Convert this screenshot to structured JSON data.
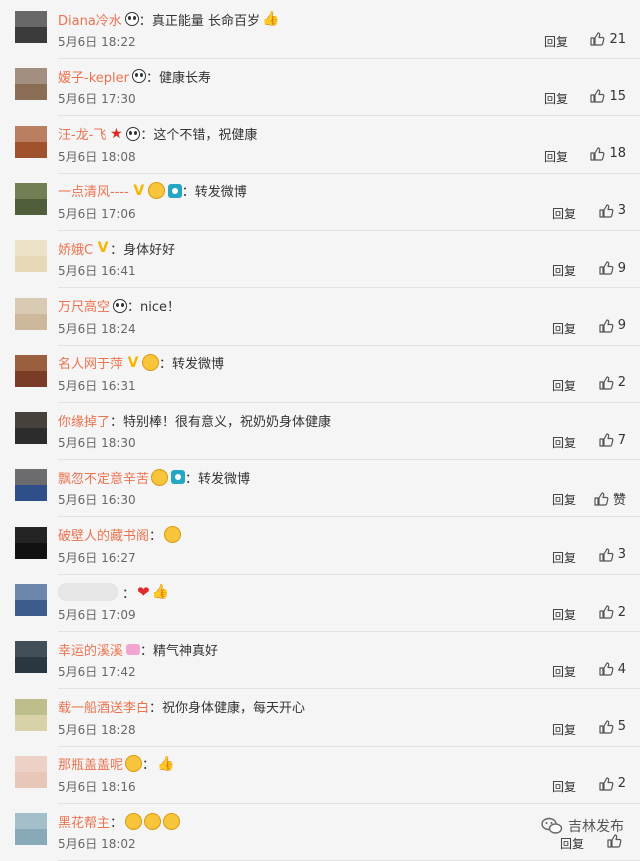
{
  "colors": {
    "username": "#eb7350",
    "text": "#333333",
    "meta": "#666666",
    "divider": "#e2e2e2"
  },
  "reply_label": "回复",
  "watermark": {
    "text": "吉林发布",
    "icon": "wechat-icon"
  },
  "comments": [
    {
      "user": "Diana冷水",
      "badges": [
        "panda"
      ],
      "text": "真正能量 长命百岁",
      "trail": [
        "thumb"
      ],
      "time": "5月6日 18:22",
      "likes": "21",
      "avatar": [
        "#3b3b3b",
        "#bdbdbd"
      ]
    },
    {
      "user": "嫒子-kepler",
      "badges": [
        "panda"
      ],
      "text": "健康长寿",
      "trail": [],
      "time": "5月6日 17:30",
      "likes": "15",
      "avatar": [
        "#8a6d55",
        "#cfcfcf"
      ]
    },
    {
      "user": "汪-龙-飞",
      "badges": [
        "star",
        "panda"
      ],
      "text": "这个不错，祝健康",
      "trail": [],
      "time": "5月6日 18:08",
      "likes": "18",
      "avatar": [
        "#a0522d",
        "#e8d4c0"
      ]
    },
    {
      "user": "一点清风----",
      "badges": [
        "v",
        "emo",
        "cam"
      ],
      "text": "转发微博",
      "trail": [],
      "time": "5月6日 17:06",
      "likes": "3",
      "avatar": [
        "#4f5d3a",
        "#b5c08a"
      ]
    },
    {
      "user": "娇娥C",
      "badges": [
        "v"
      ],
      "text": "身体好好",
      "trail": [],
      "time": "5月6日 16:41",
      "likes": "9",
      "avatar": [
        "#e7d9b8",
        "#f7f1e3"
      ]
    },
    {
      "user": "万尺高空",
      "badges": [
        "panda"
      ],
      "text": "nice！",
      "trail": [],
      "time": "5月6日 18:24",
      "likes": "9",
      "avatar": [
        "#cdb89c",
        "#f1ebe0"
      ]
    },
    {
      "user": "名人网于萍",
      "badges": [
        "v",
        "emo"
      ],
      "text": "转发微博",
      "trail": [],
      "time": "5月6日 16:31",
      "likes": "2",
      "avatar": [
        "#7a3b27",
        "#d8a46d"
      ]
    },
    {
      "user": "你缘掉了",
      "badges": [],
      "text": "特别棒！很有意义，祝奶奶身体健康",
      "trail": [],
      "time": "5月6日 18:30",
      "likes": "7",
      "avatar": [
        "#2c2c2c",
        "#7a6a58"
      ]
    },
    {
      "user": "飘忽不定意辛苦",
      "badges": [
        "emo",
        "cam"
      ],
      "text": "转发微博",
      "trail": [],
      "time": "5月6日 16:30",
      "likes": "赞",
      "avatar": [
        "#2f4f8a",
        "#e0a43a"
      ]
    },
    {
      "user": "破壁人的藏书阁",
      "badges": [],
      "text": "",
      "trail": [
        "emo"
      ],
      "time": "5月6日 16:27",
      "likes": "3",
      "avatar": [
        "#111111",
        "#444444"
      ]
    },
    {
      "user": "",
      "badges": [],
      "text": "",
      "trail": [
        "heart",
        "thumb"
      ],
      "time": "5月6日 17:09",
      "likes": "2",
      "avatar": [
        "#3d5c8c",
        "#c9d6e8"
      ],
      "blurred": true
    },
    {
      "user": "幸运的溪溪",
      "badges": [
        "pink"
      ],
      "text": "精气神真好",
      "trail": [],
      "time": "5月6日 17:42",
      "likes": "4",
      "avatar": [
        "#2b3740",
        "#6f7e88"
      ]
    },
    {
      "user": "载一船酒送李白",
      "badges": [],
      "text": "祝你身体健康，每天开心",
      "trail": [],
      "time": "5月6日 18:28",
      "likes": "5",
      "avatar": [
        "#d7d2a8",
        "#8c9b5a"
      ]
    },
    {
      "user": "那瓶盖盖呢",
      "badges": [
        "emo"
      ],
      "text": "",
      "trail": [
        "thumb"
      ],
      "time": "5月6日 18:16",
      "likes": "2",
      "avatar": [
        "#e9c7b8",
        "#f6e6df"
      ]
    },
    {
      "user": "黑花帮主",
      "badges": [],
      "text": "",
      "trail": [
        "emo",
        "emo",
        "emo"
      ],
      "time": "5月6日 18:02",
      "likes": "",
      "avatar": [
        "#87a9b8",
        "#d9e6ec"
      ]
    }
  ]
}
